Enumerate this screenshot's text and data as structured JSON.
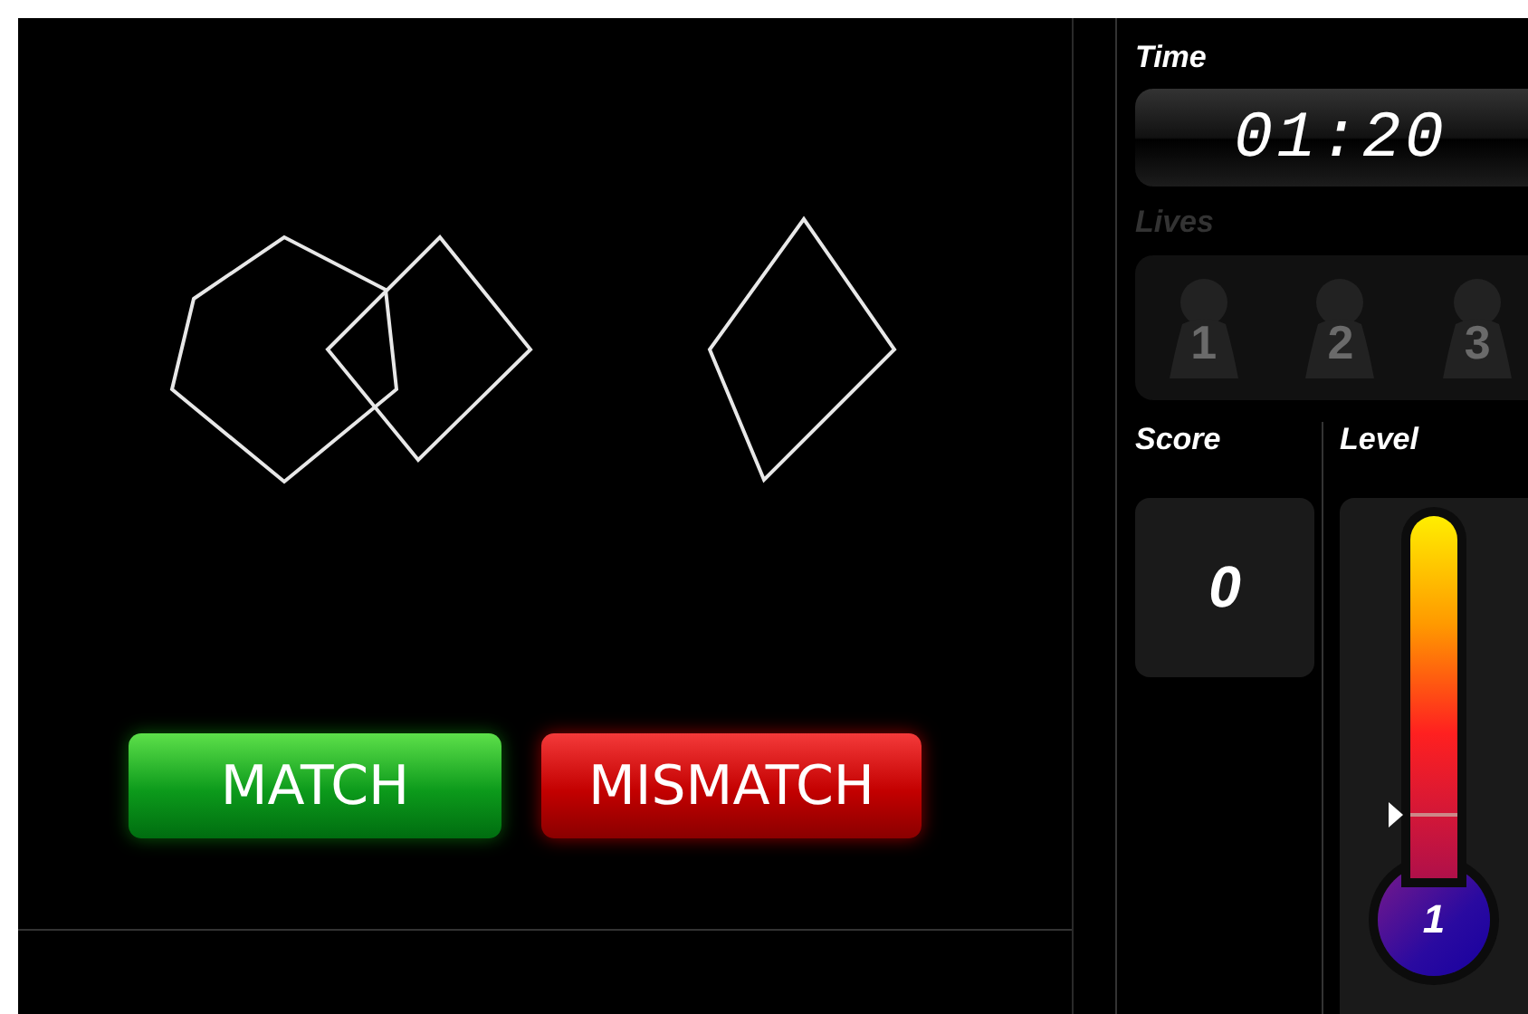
{
  "game": {
    "buttons": [
      {
        "label": "MATCH",
        "kind": "match"
      },
      {
        "label": "MISMATCH",
        "kind": "mismatch"
      }
    ]
  },
  "time": {
    "label": "Time",
    "value": "01:20"
  },
  "lives": {
    "label": "Lives",
    "disabled": true,
    "items": [
      {
        "label": "1",
        "active": false
      },
      {
        "label": "2",
        "active": false
      },
      {
        "label": "3",
        "active": false
      }
    ]
  },
  "score": {
    "label": "Score",
    "value": "0"
  },
  "level": {
    "label": "Level",
    "value": "1",
    "level": 0.17
  }
}
